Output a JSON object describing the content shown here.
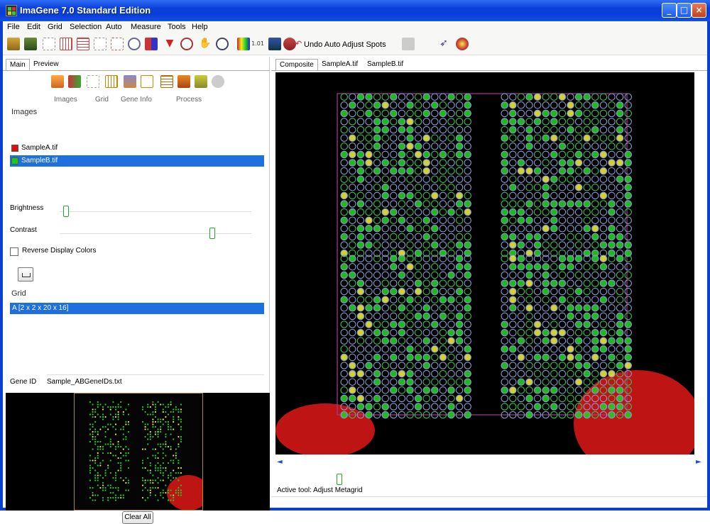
{
  "window": {
    "title": "ImaGene 7.0 Standard Edition"
  },
  "menu": [
    "File",
    "Edit",
    "Grid",
    "Selection",
    "Auto",
    "Measure",
    "Tools",
    "Help"
  ],
  "toolbar": {
    "icons": [
      "open-icon",
      "save-icon",
      "grid-icon",
      "grid-add-icon",
      "grid-edit-icon",
      "copy-icon",
      "move-icon",
      "rotate-icon",
      "flag-icon",
      "lasso-icon",
      "hand-icon",
      "zoom-icon",
      "color-icon",
      "value-icon",
      "find-spot-icon",
      "adjust-icon"
    ],
    "undo_label": "Undo Auto Adjust Spots",
    "right_icons": [
      "pointer-icon",
      "palette-icon"
    ]
  },
  "left": {
    "tabs": [
      "Main",
      "Preview"
    ],
    "process_labels": [
      "Images",
      "Grid",
      "Gene Info",
      "Process"
    ],
    "images_title": "Images",
    "images": [
      {
        "name": "SampleA.tif",
        "color": "#e01010",
        "selected": false
      },
      {
        "name": "SampleB.tif",
        "color": "#10d010",
        "selected": true
      }
    ],
    "brightness_label": "Brightness",
    "contrast_label": "Contrast",
    "brightness_value": 0.02,
    "contrast_value": 0.78,
    "reverse_label": "Reverse Display Colors",
    "grid_title": "Grid",
    "grid_item": "A [2 x 2 x 20 x 16]",
    "geneid_label": "Gene ID",
    "geneid_value": "Sample_ABGeneIDs.txt",
    "clear_label": "Clear All"
  },
  "right": {
    "tabs": [
      "Composite",
      "SampleA.tif",
      "SampleB.tif"
    ],
    "active_tool": "Active tool: Adjust Metagrid",
    "tool_value": 0.15
  },
  "colors": {
    "titlebar": "#0a3ed8",
    "selection": "#1e6fe0",
    "spot_green": "#22cc22",
    "spot_yellow": "#e8e83a",
    "ring": "#8a9cd0",
    "frame": "#a04090",
    "bleed": "#e01818"
  }
}
